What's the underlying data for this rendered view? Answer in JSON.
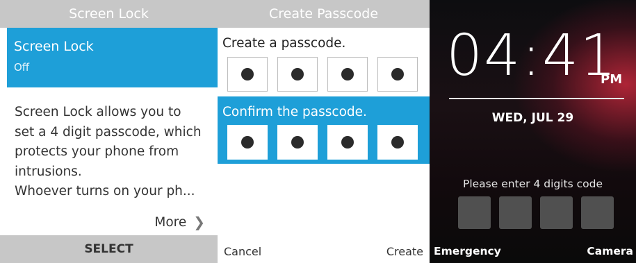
{
  "screen_lock": {
    "header": "Screen Lock",
    "item_title": "Screen Lock",
    "item_value": "Off",
    "description": "Screen Lock allows you to\nset a 4 digit passcode, which\nprotects your phone from\nintrusions.\nWhoever turns on your ph...",
    "more_label": "More",
    "footer_label": "SELECT",
    "accent": "#1e9fd8"
  },
  "create_passcode": {
    "header": "Create Passcode",
    "prompt": "Create a passcode.",
    "confirm_prompt": "Confirm the passcode.",
    "left_softkey": "Cancel",
    "right_softkey": "Create",
    "accent": "#1e9fd8"
  },
  "lock_screen": {
    "time": "04:41",
    "ampm": "PM",
    "date": "WED, JUL 29",
    "enter_prompt": "Please enter 4 digits code",
    "left_softkey": "Emergency",
    "right_softkey": "Camera"
  }
}
